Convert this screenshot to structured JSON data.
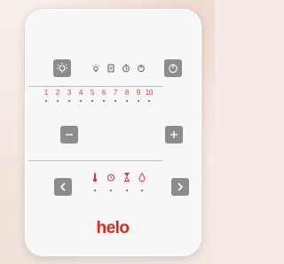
{
  "panel": {
    "brand": "helo",
    "brand_color": "#e2261c",
    "button_color": "#8c8c8c",
    "accent_color": "#d9382f"
  },
  "top_row": {
    "left_button_icon": "light-bulb-icon",
    "status_icons": [
      "light-icon",
      "sauna-heater-icon",
      "timer-icon",
      "power-indicator-icon"
    ],
    "right_button_icon": "power-icon"
  },
  "levels": [
    "1",
    "2",
    "3",
    "4",
    "5",
    "6",
    "7",
    "8",
    "9",
    "10"
  ],
  "adjust": {
    "minus_label": "−",
    "plus_label": "+"
  },
  "mode_row": {
    "left_button_icon": "chevron-left-icon",
    "mode_icons": [
      "thermometer-icon",
      "clock-icon",
      "hourglass-icon",
      "humidity-drop-icon"
    ],
    "right_button_icon": "chevron-right-icon"
  }
}
